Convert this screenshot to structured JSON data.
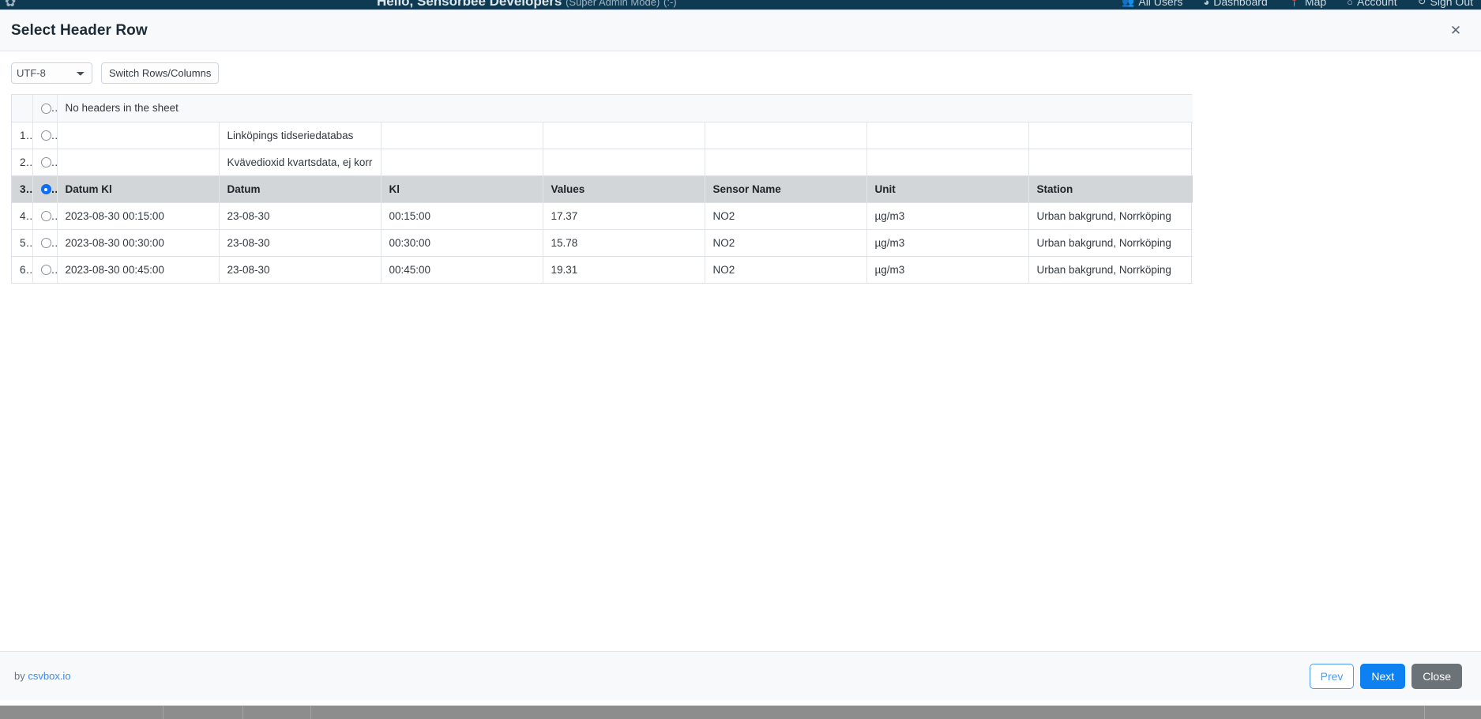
{
  "background": {
    "logo_icon": "leaf-logo-icon",
    "greeting": "Hello, Sensorbee Developers",
    "greeting_sub": "(Super Admin Mode)",
    "greeting_emoji": "(:-)",
    "nav_items": [
      {
        "icon": "users-icon",
        "label": "All Users"
      },
      {
        "icon": "dashboard-icon",
        "label": "Dashboard"
      },
      {
        "icon": "map-pin-icon",
        "label": "Map"
      },
      {
        "icon": "account-icon",
        "label": "Account"
      },
      {
        "icon": "sign-out-icon",
        "label": "Sign Out"
      }
    ],
    "navbar_color": "#0e3a52"
  },
  "modal": {
    "title": "Select Header Row",
    "close_icon": "close-icon",
    "toolbar": {
      "encoding_value": "UTF-8",
      "encoding_options": [
        "UTF-8"
      ],
      "switch_label": "Switch Rows/Columns"
    },
    "table": {
      "no_header_option_label": "No headers in the sheet",
      "no_header_selected": false,
      "selected_row_number": "3",
      "columns": 7,
      "rows": [
        {
          "number": "1",
          "selected": false,
          "is_header": false,
          "cells": [
            "",
            "Linköpings tidseriedatabas",
            "",
            "",
            "",
            "",
            ""
          ]
        },
        {
          "number": "2",
          "selected": false,
          "is_header": false,
          "cells": [
            "",
            "Kvävedioxid kvartsdata, ej korr",
            "",
            "",
            "",
            "",
            ""
          ]
        },
        {
          "number": "3",
          "selected": true,
          "is_header": true,
          "cells": [
            "Datum Kl",
            "Datum",
            "Kl",
            "Values",
            "Sensor Name",
            "Unit",
            "Station"
          ]
        },
        {
          "number": "4",
          "selected": false,
          "is_header": false,
          "cells": [
            "2023-08-30 00:15:00",
            "23-08-30",
            "00:15:00",
            "17.37",
            "NO2",
            "µg/m3",
            "Urban bakgrund, Norrköping"
          ]
        },
        {
          "number": "5",
          "selected": false,
          "is_header": false,
          "cells": [
            "2023-08-30 00:30:00",
            "23-08-30",
            "00:30:00",
            "15.78",
            "NO2",
            "µg/m3",
            "Urban bakgrund, Norrköping"
          ]
        },
        {
          "number": "6",
          "selected": false,
          "is_header": false,
          "cells": [
            "2023-08-30 00:45:00",
            "23-08-30",
            "00:45:00",
            "19.31",
            "NO2",
            "µg/m3",
            "Urban bakgrund, Norrköping"
          ]
        }
      ]
    },
    "footer": {
      "credit_prefix": "by",
      "credit_link": "csvbox.io",
      "prev_label": "Prev",
      "next_label": "Next",
      "close_label": "Close",
      "accent_color": "#0d80f2"
    }
  }
}
